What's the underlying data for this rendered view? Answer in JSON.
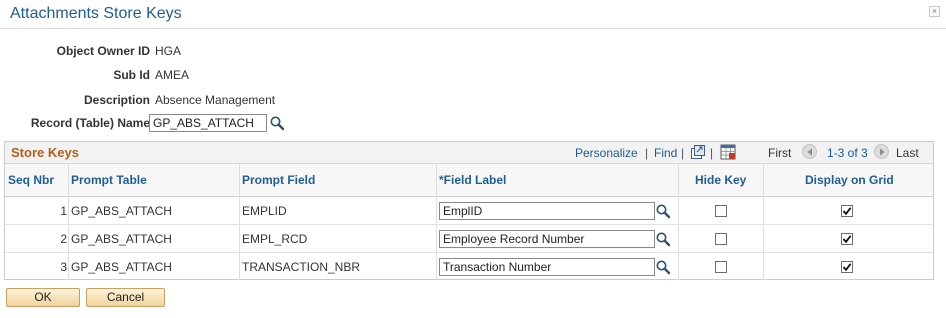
{
  "window": {
    "title": "Attachments Store Keys",
    "close_glyph": "×"
  },
  "fields": {
    "object_owner_id": {
      "label": "Object Owner ID",
      "value": "HGA"
    },
    "sub_id": {
      "label": "Sub Id",
      "value": "AMEA"
    },
    "description": {
      "label": "Description",
      "value": "Absence Management"
    },
    "record_name": {
      "label": "Record (Table) Name",
      "value": "GP_ABS_ATTACH"
    }
  },
  "grid": {
    "title": "Store Keys",
    "personalize": "Personalize",
    "find": "Find",
    "first": "First",
    "range": "1-3 of 3",
    "last": "Last",
    "sep": "|",
    "columns": {
      "seq": "Seq Nbr",
      "prompt_table": "Prompt Table",
      "prompt_field": "Prompt Field",
      "field_label": "*Field Label",
      "hide_key": "Hide Key",
      "display_on_grid": "Display on Grid"
    },
    "rows": [
      {
        "seq": "1",
        "prompt_table": "GP_ABS_ATTACH",
        "prompt_field": "EMPLID",
        "field_label": "EmplID",
        "hide_key": false,
        "display_on_grid": true
      },
      {
        "seq": "2",
        "prompt_table": "GP_ABS_ATTACH",
        "prompt_field": "EMPL_RCD",
        "field_label": "Employee Record Number",
        "hide_key": false,
        "display_on_grid": true
      },
      {
        "seq": "3",
        "prompt_table": "GP_ABS_ATTACH",
        "prompt_field": "TRANSACTION_NBR",
        "field_label": "Transaction Number",
        "hide_key": false,
        "display_on_grid": true
      }
    ]
  },
  "buttons": {
    "ok": "OK",
    "cancel": "Cancel"
  },
  "colors": {
    "title": "#1d5c94",
    "section_title": "#b35f19",
    "link": "#1a5a98",
    "button_bg": "#f1d29a"
  }
}
